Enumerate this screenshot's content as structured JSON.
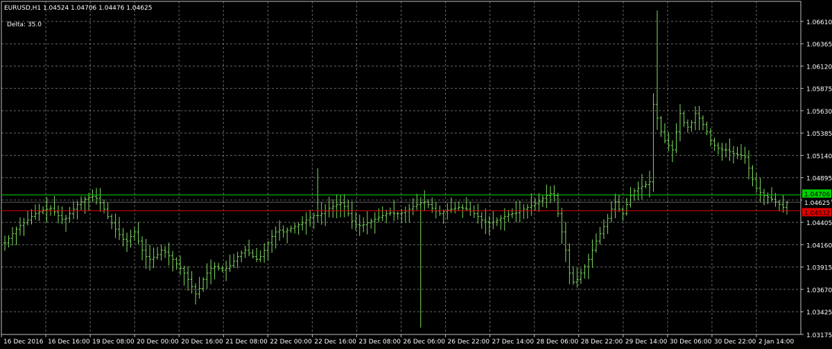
{
  "header": {
    "symbol": "EURUSD,H1",
    "ohlc": "1.04524 1.04706 1.04476 1.04625",
    "delta": "Delta: 35.0"
  },
  "colors": {
    "background": "#000000",
    "grid": "#c0c0c0",
    "bars": "#80e060",
    "axis_text": "#ffffff",
    "high_line": "#00d000",
    "low_line": "#e00000",
    "bid_line": "#c0c0c0"
  },
  "price_labels": [
    {
      "value": "1.04706",
      "bg": "#00d000",
      "fg": "#000000"
    },
    {
      "value": "1.04625",
      "bg": "#000000",
      "fg": "#ffffff"
    },
    {
      "value": "1.04532",
      "bg": "#e00000",
      "fg": "#000000"
    }
  ],
  "chart_data": {
    "type": "bar",
    "title": "EURUSD,H1",
    "ylim": [
      1.03175,
      1.0683
    ],
    "yticks": [
      "1.06610",
      "1.06365",
      "1.06120",
      "1.05875",
      "1.05630",
      "1.05385",
      "1.05140",
      "1.04895",
      "1.04650",
      "1.04405",
      "1.04160",
      "1.03915",
      "1.03670",
      "1.03425",
      "1.03175"
    ],
    "xticks": [
      "16 Dec 2016",
      "16 Dec 16:00",
      "19 Dec 08:00",
      "20 Dec 00:00",
      "20 Dec 16:00",
      "21 Dec 08:00",
      "22 Dec 00:00",
      "22 Dec 16:00",
      "23 Dec 08:00",
      "26 Dec 06:00",
      "26 Dec 22:00",
      "27 Dec 14:00",
      "28 Dec 06:00",
      "28 Dec 22:00",
      "29 Dec 14:00",
      "30 Dec 06:00",
      "30 Dec 22:00",
      "2 Jan 14:00"
    ],
    "grid": true,
    "horizontal_lines": [
      1.04706,
      1.04625,
      1.04532
    ],
    "series": [
      {
        "values": [
          1.0418,
          1.0423,
          1.0428,
          1.0433,
          1.0437,
          1.044,
          1.0443,
          1.0447,
          1.045,
          1.0452,
          1.0454,
          1.0455,
          1.0456,
          1.0452,
          1.0448,
          1.0444,
          1.0445,
          1.045,
          1.0455,
          1.046,
          1.0463,
          1.0466,
          1.0468,
          1.0469,
          1.0467,
          1.0462,
          1.0455,
          1.0447,
          1.044,
          1.0433,
          1.0427,
          1.0422,
          1.042,
          1.0425,
          1.043,
          1.042,
          1.041,
          1.0403,
          1.04,
          1.0402,
          1.0405,
          1.041,
          1.0408,
          1.0404,
          1.04,
          1.0395,
          1.039,
          1.0385,
          1.0378,
          1.037,
          1.0362,
          1.0368,
          1.0378,
          1.0385,
          1.039,
          1.0392,
          1.039,
          1.0388,
          1.039,
          1.0393,
          1.0398,
          1.0403,
          1.0407,
          1.041,
          1.0407,
          1.0403,
          1.04,
          1.0403,
          1.041,
          1.0418,
          1.0425,
          1.043,
          1.0432,
          1.043,
          1.0432,
          1.0434,
          1.0436,
          1.0438,
          1.044,
          1.0443,
          1.0446,
          1.0448,
          1.0448,
          1.045,
          1.0453,
          1.0456,
          1.0458,
          1.046,
          1.0462,
          1.0458,
          1.045,
          1.0442,
          1.0438,
          1.0437,
          1.0438,
          1.044,
          1.0442,
          1.0444,
          1.0446,
          1.0448,
          1.045,
          1.0451,
          1.045,
          1.045,
          1.0451,
          1.0453,
          1.0455,
          1.0458,
          1.046,
          1.0462,
          1.0463,
          1.046,
          1.0456,
          1.0453,
          1.045,
          1.0452,
          1.0454,
          1.0455,
          1.0456,
          1.0457,
          1.0456,
          1.0455,
          1.0453,
          1.045,
          1.0447,
          1.0443,
          1.0441,
          1.044,
          1.0441,
          1.0443,
          1.0445,
          1.0447,
          1.0449,
          1.045,
          1.0451,
          1.0453,
          1.0455,
          1.0457,
          1.0459,
          1.0461,
          1.0464,
          1.0467,
          1.047,
          1.0472,
          1.047,
          1.045,
          1.043,
          1.041,
          1.0385,
          1.0375,
          1.0378,
          1.0385,
          1.0392,
          1.04,
          1.041,
          1.042,
          1.0428,
          1.0436,
          1.0445,
          1.0455,
          1.0463,
          1.0455,
          1.045,
          1.046,
          1.047,
          1.0475,
          1.0478,
          1.048,
          1.0482,
          1.0485,
          1.057,
          1.0555,
          1.054,
          1.053,
          1.0525,
          1.052,
          1.054,
          1.056,
          1.055,
          1.0545,
          1.055,
          1.056,
          1.0555,
          1.0548,
          1.054,
          1.053,
          1.0525,
          1.0522,
          1.052,
          1.052,
          1.0518,
          1.0516,
          1.0515,
          1.0514,
          1.0512,
          1.05,
          1.0488,
          1.0478,
          1.0473,
          1.047,
          1.0468,
          1.0466,
          1.0463,
          1.046,
          1.0457,
          1.0462
        ]
      }
    ]
  }
}
